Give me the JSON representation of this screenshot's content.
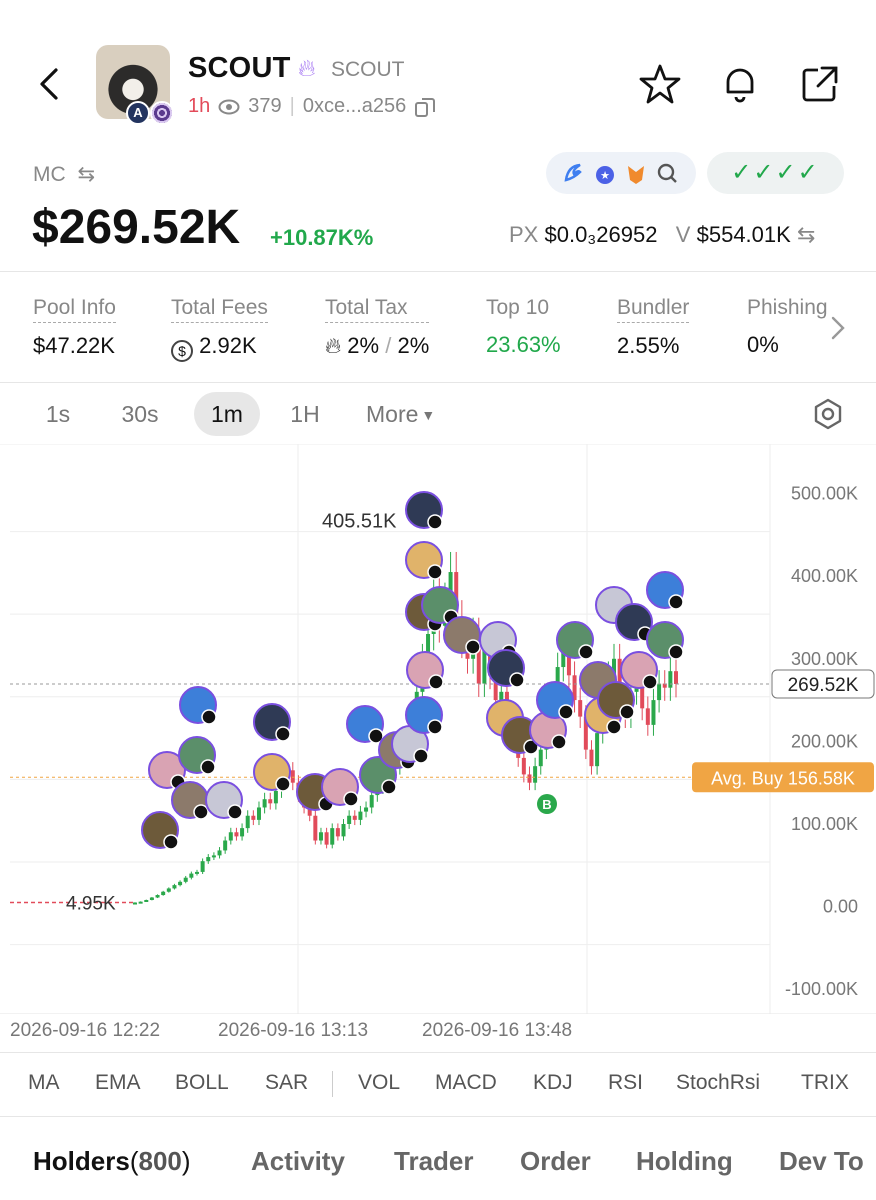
{
  "header": {
    "title": "SCOUT",
    "ticker": "SCOUT",
    "age": "1h",
    "views": "379",
    "address": "0xce...a256",
    "avatar_badge": "A"
  },
  "market": {
    "label": "MC",
    "value": "$269.52K",
    "change": "+10.87K%",
    "px_label": "PX",
    "px_value": "$0.0₃26952",
    "v_label": "V",
    "v_value": "$554.01K",
    "checks": "✓✓✓✓"
  },
  "stats": [
    {
      "label": "Pool Info",
      "value": "$47.22K"
    },
    {
      "label": "Total Fees",
      "value": "2.92K"
    },
    {
      "label": "Total Tax",
      "value": "2%",
      "value2": "2%"
    },
    {
      "label": "Top 10",
      "value": "23.63%"
    },
    {
      "label": "Bundler",
      "value": "2.55%"
    },
    {
      "label": "Phishing",
      "value": "0%"
    }
  ],
  "timeframes": [
    "1s",
    "30s",
    "1m",
    "1H",
    "More"
  ],
  "active_timeframe": "1m",
  "chart_data": {
    "type": "candlestick",
    "y_ticks": [
      "500.00K",
      "400.00K",
      "300.00K",
      "200.00K",
      "100.00K",
      "0.00",
      "-100.00K"
    ],
    "ylim": [
      -130000,
      560000
    ],
    "current_label": "269.52K",
    "current_value": 269520,
    "avg_buy_label": "Avg. Buy 156.58K",
    "avg_buy_value": 156580,
    "high_label": "405.51K",
    "high_value": 405510,
    "low_label": "4.95K",
    "low_value": 4950,
    "x_labels": [
      "2026-09-16 12:22",
      "2026-09-16 13:13",
      "2026-09-16 13:48"
    ],
    "buy_marker": "B",
    "close_values": [
      4.95,
      6,
      8,
      11,
      14,
      18,
      22,
      26,
      30,
      35,
      40,
      42,
      55,
      60,
      62,
      68,
      80,
      90,
      85,
      95,
      110,
      105,
      120,
      130,
      125,
      140,
      150,
      165,
      150,
      135,
      120,
      110,
      80,
      90,
      75,
      95,
      85,
      100,
      110,
      105,
      115,
      120,
      135,
      145,
      150,
      160,
      170,
      180,
      200,
      220,
      260,
      300,
      330,
      380,
      340,
      370,
      405,
      350,
      320,
      300,
      330,
      270,
      310,
      280,
      250,
      260,
      230,
      200,
      180,
      160,
      150,
      170,
      190,
      210,
      250,
      290,
      310,
      280,
      250,
      230,
      190,
      170,
      210,
      240,
      280,
      300,
      250,
      230,
      260,
      280,
      240,
      220,
      250,
      270,
      265,
      285,
      269.52
    ]
  },
  "indicators": [
    "MA",
    "EMA",
    "BOLL",
    "SAR",
    "VOL",
    "MACD",
    "KDJ",
    "RSI",
    "StochRsi",
    "TRIX"
  ],
  "bottom_tabs": {
    "holders": "Holders",
    "holders_count": "800",
    "activity": "Activity",
    "trader": "Trader",
    "order": "Order",
    "holding": "Holding",
    "devtokens": "Dev To"
  },
  "colors": {
    "up": "#2aa84b",
    "down": "#e14b5a",
    "avg": "#f0a544",
    "accent": "#7a4fe0"
  }
}
